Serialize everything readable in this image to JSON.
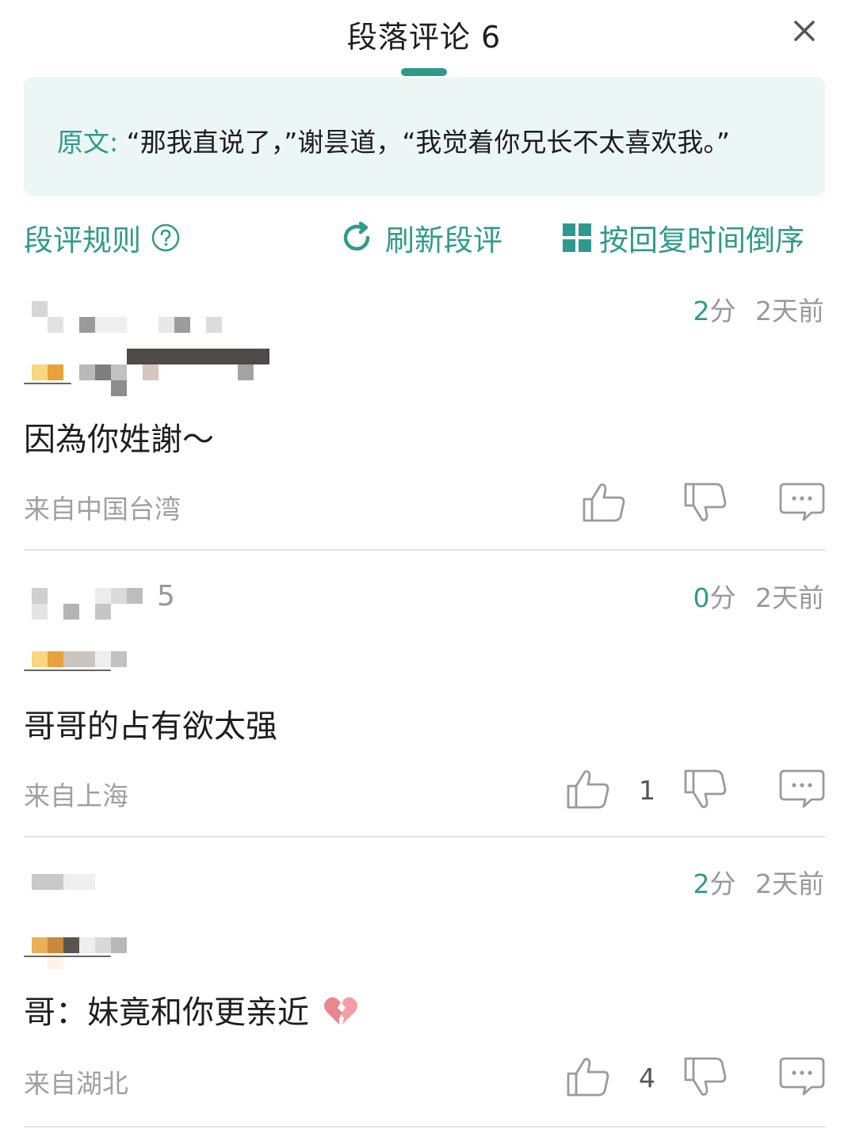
{
  "header": {
    "title": "段落评论 6"
  },
  "original": {
    "label": "原文:",
    "text": "“那我直说了，”谢昙道，“我觉着你兄长不太喜欢我。”"
  },
  "toolbar": {
    "rules": "段评规则",
    "refresh": "刷新段评",
    "sort": "按回复时间倒序"
  },
  "comments": [
    {
      "score_num": "2",
      "score_unit": "分",
      "time": "2天前",
      "level": "",
      "text": "因為你姓謝～",
      "location": "来自中国台湾",
      "likes": ""
    },
    {
      "score_num": "0",
      "score_unit": "分",
      "time": "2天前",
      "level": "5",
      "text": "哥哥的占有欲太强",
      "location": "来自上海",
      "likes": "1"
    },
    {
      "score_num": "2",
      "score_unit": "分",
      "time": "2天前",
      "level": "",
      "text": "哥：妹竟和你更亲近",
      "location": "来自湖北",
      "likes": "4"
    }
  ],
  "colors": {
    "accent": "#2f9a8b",
    "quote_bg": "#ecf6f4",
    "muted": "#a0a0a0"
  },
  "icons": [
    "close-icon",
    "help-circle-icon",
    "refresh-icon",
    "grid-sort-icon",
    "thumbs-up-icon",
    "thumbs-down-icon",
    "comment-bubble-icon",
    "broken-heart-emoji"
  ]
}
